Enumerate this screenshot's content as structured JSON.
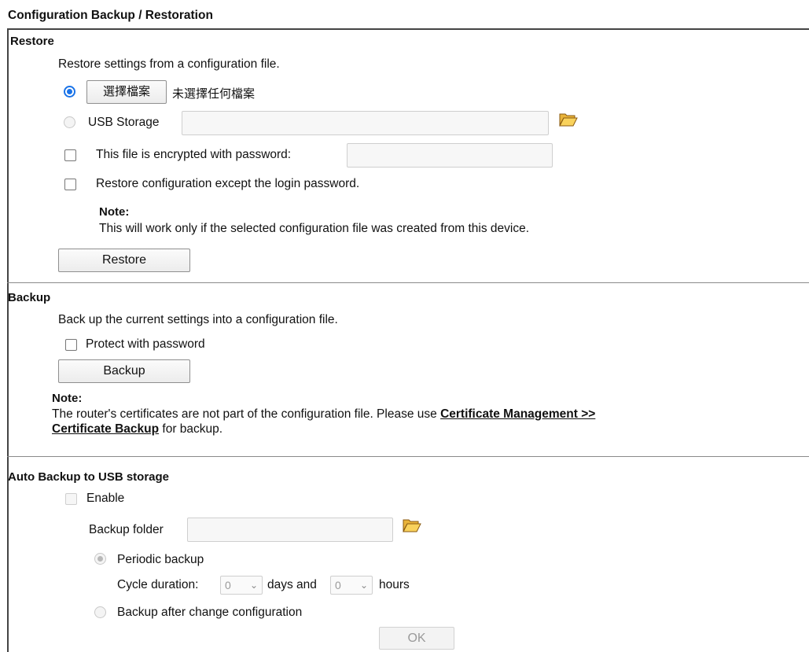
{
  "page_title": "Configuration Backup / Restoration",
  "restore": {
    "title": "Restore",
    "description": "Restore settings from a configuration file.",
    "choose_file_label": "選擇檔案",
    "no_file_text": "未選擇任何檔案",
    "usb_storage_label": "USB Storage",
    "usb_storage_value": "",
    "encrypted_label": "This file is encrypted with password:",
    "encrypted_password_value": "",
    "except_login_label": "Restore configuration except the login password.",
    "note_title": "Note:",
    "note_text": "This will work only if the selected configuration file was created from this device.",
    "restore_button": "Restore"
  },
  "backup": {
    "title": "Backup",
    "description": "Back up the current settings into a configuration file.",
    "protect_label": "Protect with password",
    "backup_button": "Backup",
    "note_title": "Note:",
    "note_text_1": "The router's certificates are not part of the configuration file. Please use ",
    "note_link_1": "Certificate Management >>",
    "note_link_2": "Certificate Backup",
    "note_text_2": " for backup."
  },
  "auto_backup": {
    "title": "Auto Backup to USB storage",
    "enable_label": "Enable",
    "backup_folder_label": "Backup folder",
    "backup_folder_value": "",
    "periodic_label": "Periodic backup",
    "cycle_label": "Cycle duration:",
    "days_value": "0",
    "days_and_label": "days and",
    "hours_value": "0",
    "hours_label": "hours",
    "after_change_label": "Backup after change configuration",
    "ok_button": "OK"
  },
  "icons": {
    "folder": "folder-icon",
    "dropdown": "chevron-down-icon"
  },
  "colors": {
    "radio_checked": "#1a73e8",
    "border": "#444444"
  }
}
